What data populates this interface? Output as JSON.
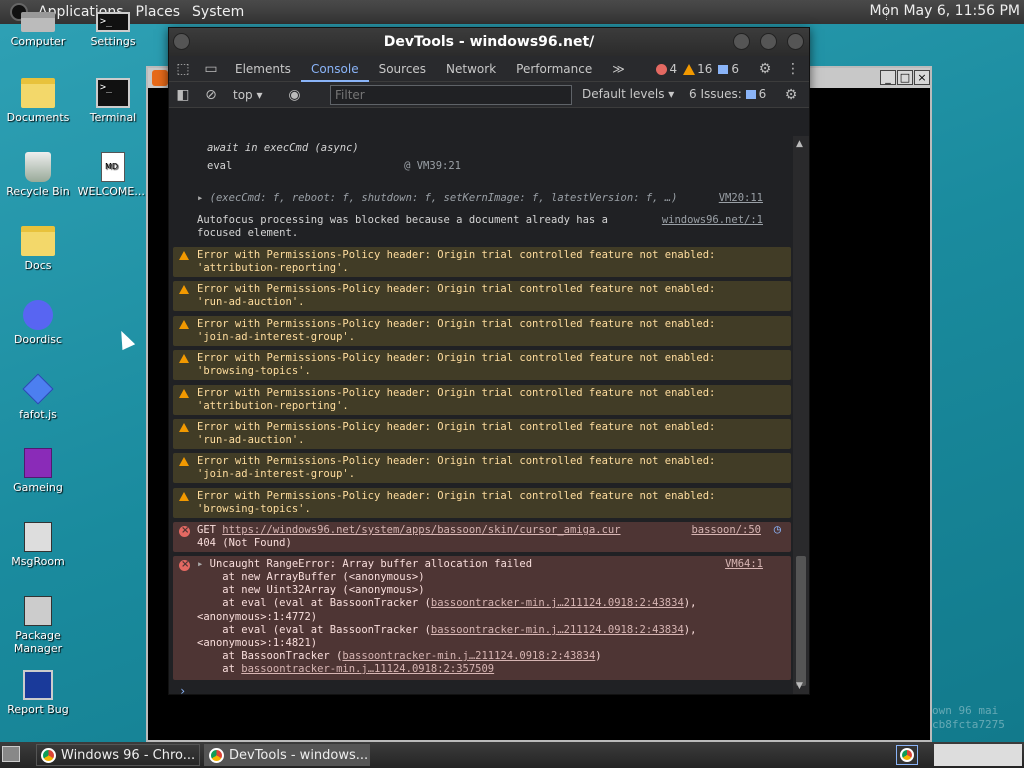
{
  "top_panel": {
    "menus": [
      "Applications",
      "Places",
      "System"
    ],
    "clock": "Mon May  6, 11:56 PM"
  },
  "desktop_icons": [
    {
      "label": "Computer",
      "icon": "computer-icon"
    },
    {
      "label": "Settings",
      "icon": "settings-icon"
    },
    {
      "label": "Documents",
      "icon": "folder-icon"
    },
    {
      "label": "Terminal",
      "icon": "terminal-icon"
    },
    {
      "label": "Recycle Bin",
      "icon": "recycle-bin-icon"
    },
    {
      "label": "WELCOME....",
      "icon": "markdown-file-icon"
    },
    {
      "label": "Docs",
      "icon": "folder-icon"
    },
    {
      "label": "Doordisc",
      "icon": "discord-icon"
    },
    {
      "label": "fafot.js",
      "icon": "diamond-icon"
    },
    {
      "label": "Gameing",
      "icon": "cube-icon"
    },
    {
      "label": "MsgRoom",
      "icon": "msgroom-icon"
    },
    {
      "label": "Package Manager",
      "icon": "package-icon"
    },
    {
      "label": "Report Bug",
      "icon": "report-bug-icon"
    }
  ],
  "devtools": {
    "title": "DevTools - windows96.net/",
    "tabs": [
      "Elements",
      "Console",
      "Sources",
      "Network",
      "Performance"
    ],
    "active_tab": "Console",
    "more_tabs": "≫",
    "error_count": "4",
    "warning_count": "16",
    "info_count": "6",
    "context": "top",
    "filter_placeholder": "Filter",
    "default_levels": "Default levels",
    "issues_label": "6 Issues:",
    "issues_count": "6",
    "prompt": "›"
  },
  "console": {
    "line1": "await in execCmd (async)",
    "line2_label": "eval",
    "line2_src": "@ VM39:21",
    "obj_line": "(execCmd: f, reboot: f, shutdown: f, setKernImage: f, latestVersion: f, …)",
    "obj_src": "VM20:11",
    "autofocus_l1": "Autofocus processing was blocked because a document already has a",
    "autofocus_l2": "focused element.",
    "autofocus_src": "windows96.net/:1",
    "warn_prefix": "Error with Permissions-Policy header: Origin trial controlled feature not enabled:",
    "warnings": [
      "'attribution-reporting'.",
      "'run-ad-auction'.",
      "'join-ad-interest-group'.",
      "'browsing-topics'.",
      "'attribution-reporting'.",
      "'run-ad-auction'.",
      "'join-ad-interest-group'.",
      "'browsing-topics'."
    ],
    "get_prefix": "GET",
    "get_url": "https://windows96.net/system/apps/bassoon/skin/cursor_amiga.cur",
    "get_status": "404 (Not Found)",
    "get_src": "bassoon/:50",
    "uncaught": "Uncaught RangeError: Array buffer allocation failed",
    "uncaught_src": "VM64:1",
    "stack": [
      "    at new ArrayBuffer (<anonymous>)",
      "    at new Uint32Array (<anonymous>)"
    ],
    "stack_eval_prefix": "    at eval (eval at BassoonTracker (",
    "stack_link": "bassoontracker-min.j…211124.0918:2:43834",
    "stack_eval_suffix": "),",
    "stack_anon1": "<anonymous>:1:4772)",
    "stack_anon2": "<anonymous>:1:4821)",
    "stack_bt_prefix": "    at BassoonTracker (",
    "stack_bt_suffix": ")",
    "stack_last_prefix": "    at ",
    "stack_last_link": "bassoontracker-min.j…11124.0918:2:357509"
  },
  "taskbar": {
    "tasks": [
      "Windows 96 - Chro...",
      "DevTools - windows..."
    ]
  },
  "watermark": [
    "own 96 mai",
    "cb8fcta7275"
  ]
}
